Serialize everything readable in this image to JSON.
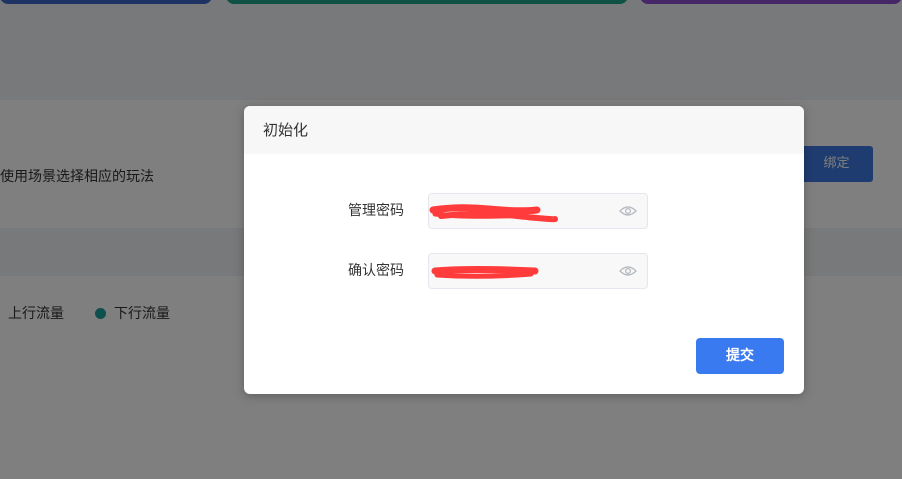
{
  "background": {
    "hint_text": "使用场景选择相应的玩法",
    "bind_button_label": "绑定",
    "legend": {
      "upstream_label": "上行流量",
      "downstream_label": "下行流量",
      "downstream_color": "#1f9e9a"
    },
    "top_card_colors": [
      "#3d64c9",
      "#1fa38a",
      "#8a4fd0"
    ]
  },
  "dialog": {
    "title": "初始化",
    "fields": [
      {
        "label": "管理密码",
        "value": "",
        "type": "password",
        "icon": "eye-icon",
        "redacted": true
      },
      {
        "label": "确认密码",
        "value": "",
        "type": "password",
        "icon": "eye-icon",
        "redacted": true
      }
    ],
    "submit_label": "提交",
    "accent_color": "#3a7af0",
    "redaction_color": "#ff3b3b"
  }
}
